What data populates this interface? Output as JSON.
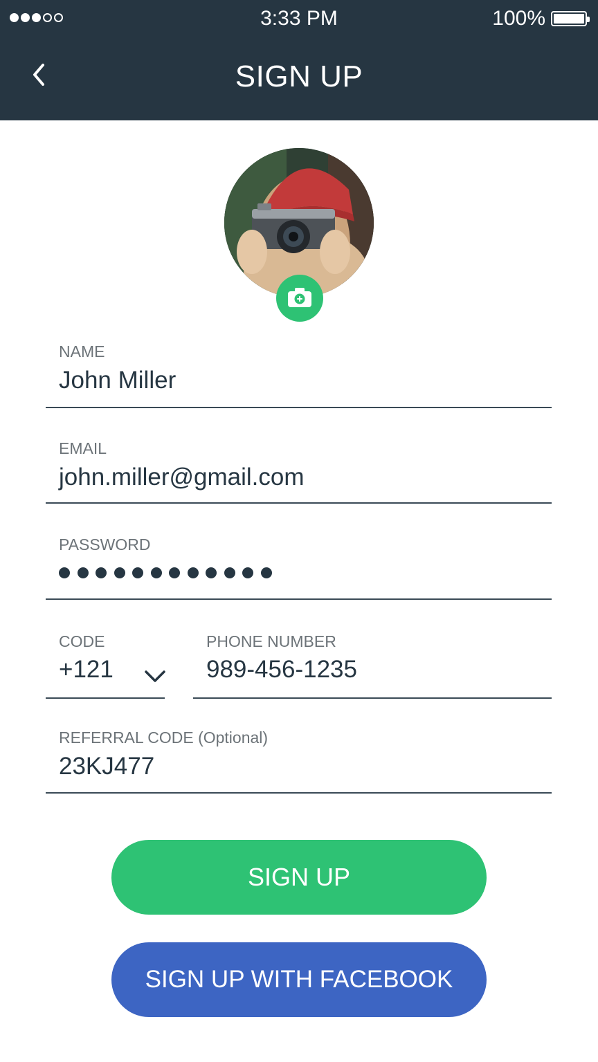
{
  "status_bar": {
    "time": "3:33 PM",
    "battery": "100%",
    "signal_bars_filled": 3,
    "signal_bars_total": 5
  },
  "header": {
    "title": "SIGN UP",
    "back_icon": "chevron-left-icon"
  },
  "avatar": {
    "camera_icon": "camera-add-icon",
    "badge_color": "#2ec274"
  },
  "form": {
    "name": {
      "label": "NAME",
      "value": "John Miller"
    },
    "email": {
      "label": "EMAIL",
      "value": "john.miller@gmail.com"
    },
    "password": {
      "label": "PASSWORD",
      "masked_length": 12
    },
    "code": {
      "label": "CODE",
      "value": "+121",
      "dropdown_icon": "chevron-down-icon"
    },
    "phone": {
      "label": "PHONE NUMBER",
      "value": "989-456-1235"
    },
    "referral": {
      "label": "REFERRAL CODE (Optional)",
      "value": "23KJ477"
    }
  },
  "buttons": {
    "sign_up": "SIGN UP",
    "sign_up_facebook": "SIGN UP WITH FACEBOOK"
  },
  "colors": {
    "header_bg": "#263642",
    "primary_green": "#2ec274",
    "facebook_blue": "#3d65c3",
    "text_dark": "#263642",
    "label_gray": "#6c7378"
  }
}
